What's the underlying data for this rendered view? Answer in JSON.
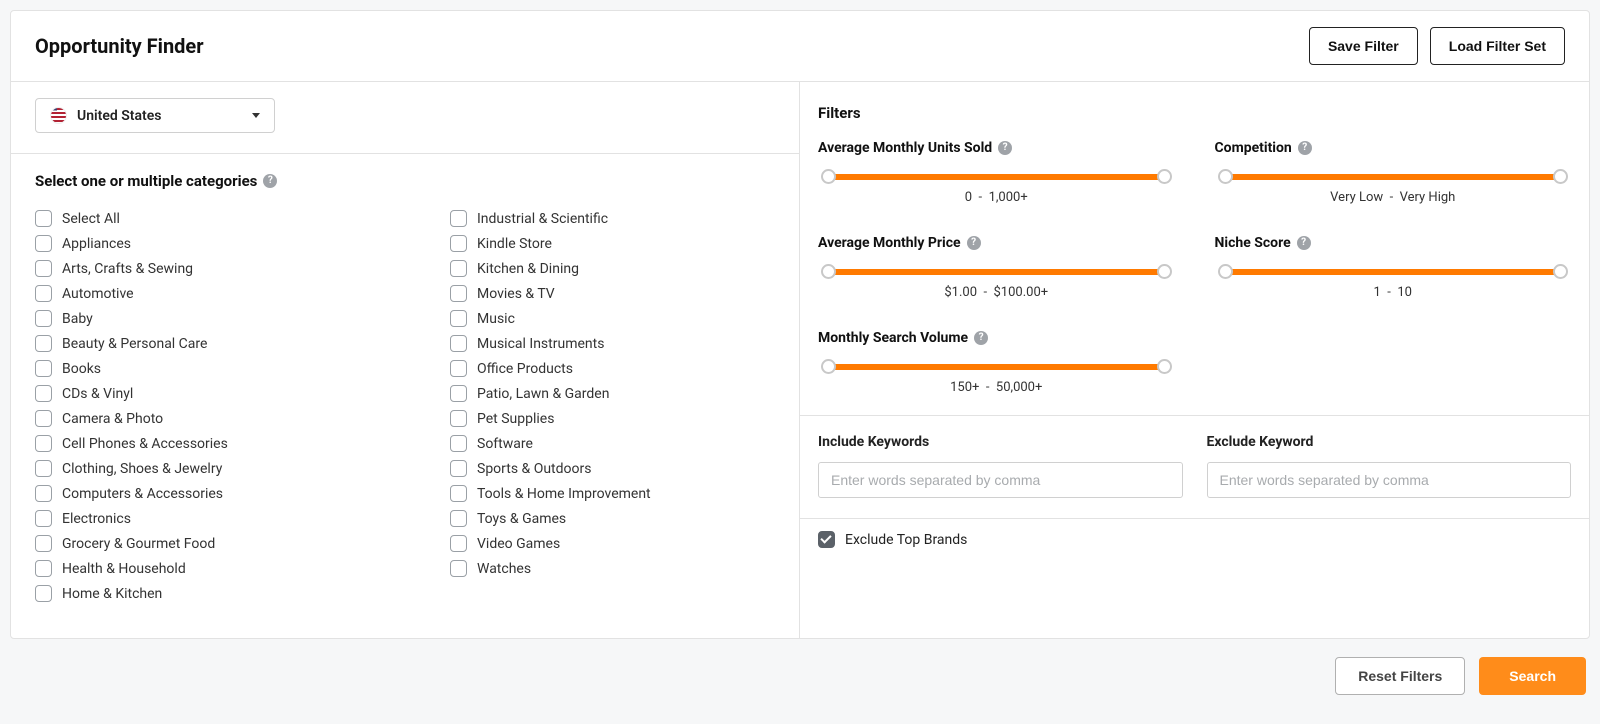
{
  "title": "Opportunity Finder",
  "header": {
    "save": "Save Filter",
    "load": "Load Filter Set"
  },
  "country": {
    "selected": "United States"
  },
  "categories": {
    "title": "Select one or multiple categories",
    "select_all": "Select All",
    "col1": [
      "Appliances",
      "Arts, Crafts & Sewing",
      "Automotive",
      "Baby",
      "Beauty & Personal Care",
      "Books",
      "CDs & Vinyl",
      "Camera & Photo",
      "Cell Phones & Accessories",
      "Clothing, Shoes & Jewelry",
      "Computers & Accessories",
      "Electronics",
      "Grocery & Gourmet Food",
      "Health & Household",
      "Home & Kitchen"
    ],
    "col2": [
      "Industrial & Scientific",
      "Kindle Store",
      "Kitchen & Dining",
      "Movies & TV",
      "Music",
      "Musical Instruments",
      "Office Products",
      "Patio, Lawn & Garden",
      "Pet Supplies",
      "Software",
      "Sports & Outdoors",
      "Tools & Home Improvement",
      "Toys & Games",
      "Video Games",
      "Watches"
    ]
  },
  "filters": {
    "title": "Filters",
    "units": {
      "label": "Average Monthly Units Sold",
      "range": "0  -  1,000+"
    },
    "competition": {
      "label": "Competition",
      "range": "Very Low  -  Very High"
    },
    "price": {
      "label": "Average Monthly Price",
      "range": "$1.00  -  $100.00+"
    },
    "niche": {
      "label": "Niche Score",
      "range": "1  -  10"
    },
    "search": {
      "label": "Monthly Search Volume",
      "range": "150+  -  50,000+"
    }
  },
  "keywords": {
    "include_label": "Include Keywords",
    "exclude_label": "Exclude Keyword",
    "placeholder": "Enter words separated by comma"
  },
  "exclude_brands": {
    "label": "Exclude Top Brands",
    "checked": true
  },
  "footer": {
    "reset": "Reset Filters",
    "search": "Search"
  }
}
